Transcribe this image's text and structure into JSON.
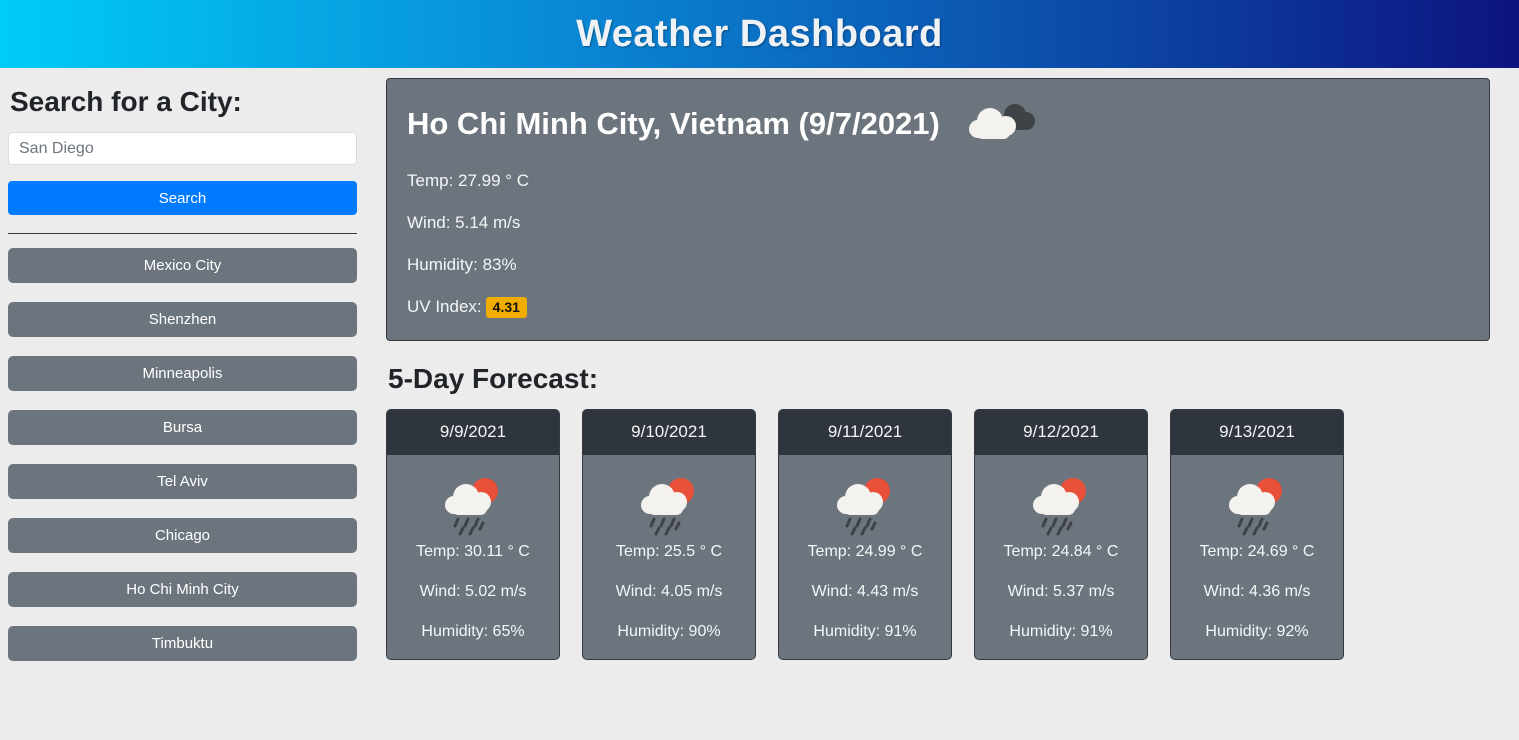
{
  "header": {
    "title": "Weather Dashboard",
    "gradient_start": "#00ccf8",
    "gradient_end": "#0d137f"
  },
  "sidebar": {
    "heading": "Search for a City:",
    "search": {
      "placeholder": "San Diego",
      "value": "",
      "button_label": "Search"
    },
    "history_label": "city-history",
    "cities": [
      {
        "label": "Mexico City"
      },
      {
        "label": "Shenzhen"
      },
      {
        "label": "Minneapolis"
      },
      {
        "label": "Bursa"
      },
      {
        "label": "Tel Aviv"
      },
      {
        "label": "Chicago"
      },
      {
        "label": "Ho Chi Minh City"
      },
      {
        "label": "Timbuktu"
      }
    ]
  },
  "current": {
    "title": "Ho Chi Minh City, Vietnam (9/7/2021)",
    "icon": "broken-clouds-icon",
    "temp": "Temp: 27.99 ° C",
    "wind": "Wind: 5.14 m/s",
    "humidity": "Humidity: 83%",
    "uv_label": "UV Index:",
    "uv_value": "4.31",
    "uv_badge_color": "#f0ad00",
    "card_bg": "#6c757d"
  },
  "forecast": {
    "heading": "5-Day Forecast:",
    "days": [
      {
        "date": "9/9/2021",
        "icon": "rain-with-sun-icon",
        "temp": "Temp: 30.11 ° C",
        "wind": "Wind: 5.02 m/s",
        "humidity": "Humidity: 65%"
      },
      {
        "date": "9/10/2021",
        "icon": "rain-with-sun-icon",
        "temp": "Temp: 25.5 ° C",
        "wind": "Wind: 4.05 m/s",
        "humidity": "Humidity: 90%"
      },
      {
        "date": "9/11/2021",
        "icon": "rain-with-sun-icon",
        "temp": "Temp: 24.99 ° C",
        "wind": "Wind: 4.43 m/s",
        "humidity": "Humidity: 91%"
      },
      {
        "date": "9/12/2021",
        "icon": "rain-with-sun-icon",
        "temp": "Temp: 24.84 ° C",
        "wind": "Wind: 5.37 m/s",
        "humidity": "Humidity: 91%"
      },
      {
        "date": "9/13/2021",
        "icon": "rain-with-sun-icon",
        "temp": "Temp: 24.69 ° C",
        "wind": "Wind: 4.36 m/s",
        "humidity": "Humidity: 92%"
      }
    ]
  }
}
